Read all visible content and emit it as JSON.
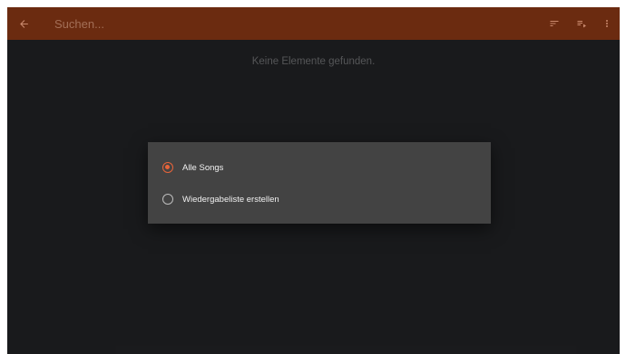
{
  "toolbar": {
    "back_icon": "arrow-back-icon",
    "search_placeholder": "Suchen...",
    "sort_icon": "sort-icon",
    "queue_icon": "playlist-icon",
    "more_icon": "more-vert-icon"
  },
  "main": {
    "empty_message": "Keine Elemente gefunden."
  },
  "dialog": {
    "options": [
      {
        "label": "Alle Songs",
        "selected": true
      },
      {
        "label": "Wiedergabeliste erstellen",
        "selected": false
      }
    ]
  },
  "colors": {
    "toolbar": "#6b2b10",
    "background": "#1c1d1f",
    "dialog": "#434343",
    "accent": "#e8643a"
  }
}
